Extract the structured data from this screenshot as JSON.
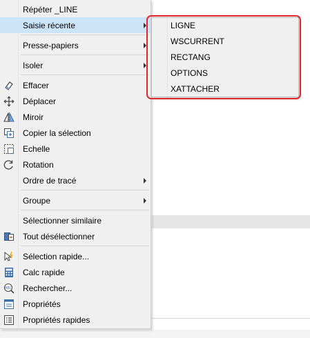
{
  "context_menu": {
    "items": [
      {
        "label": "Répéter _LINE",
        "icon": ""
      },
      {
        "label": "Saisie récente",
        "icon": "",
        "submenu": true,
        "highlighted": true
      },
      {
        "label": "Presse-papiers",
        "icon": "",
        "submenu": true
      },
      {
        "label": "Isoler",
        "icon": "",
        "submenu": true
      },
      {
        "label": "Effacer",
        "icon": "eraser-icon"
      },
      {
        "label": "Déplacer",
        "icon": "move-icon"
      },
      {
        "label": "Miroir",
        "icon": "mirror-icon"
      },
      {
        "label": "Copier la sélection",
        "icon": "copy-selection-icon"
      },
      {
        "label": "Echelle",
        "icon": "scale-icon"
      },
      {
        "label": "Rotation",
        "icon": "rotate-icon"
      },
      {
        "label": "Ordre de tracé",
        "icon": "",
        "submenu": true
      },
      {
        "label": "Groupe",
        "icon": "",
        "submenu": true
      },
      {
        "label": "Sélectionner similaire",
        "icon": ""
      },
      {
        "label": "Tout désélectionner",
        "icon": "deselect-all-icon"
      },
      {
        "label": "Sélection rapide...",
        "icon": "quick-select-icon"
      },
      {
        "label": "Calc rapide",
        "icon": "calculator-icon"
      },
      {
        "label": "Rechercher...",
        "icon": "find-icon"
      },
      {
        "label": "Propriétés",
        "icon": "properties-icon"
      },
      {
        "label": "Propriétés rapides",
        "icon": "quick-properties-icon"
      }
    ]
  },
  "recent_input_submenu": {
    "items": [
      "LIGNE",
      "WSCURRENT",
      "RECTANG",
      "OPTIONS",
      "XATTACHER"
    ]
  },
  "colors": {
    "highlight": "#cce4f7",
    "annotation_frame": "#e0262d",
    "menu_background": "#f0f0f0"
  }
}
